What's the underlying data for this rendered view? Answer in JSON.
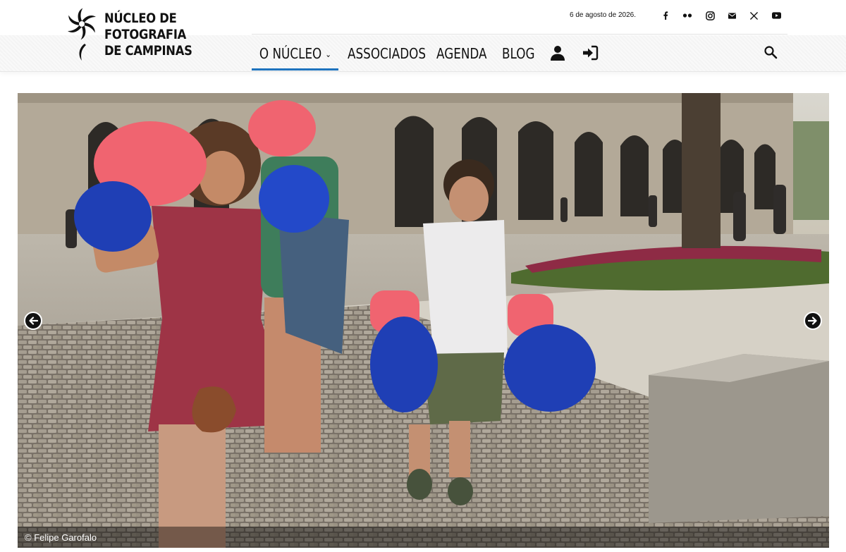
{
  "site": {
    "logo_lines": [
      "NÚCLEO DE",
      "FOTOGRAFIA",
      "DE CAMPINAS"
    ]
  },
  "topbar": {
    "date": "6 de agosto de 2026.",
    "social_icons": [
      "facebook-icon",
      "flickr-icon",
      "instagram-icon",
      "mail-icon",
      "x-icon",
      "youtube-icon"
    ]
  },
  "nav": {
    "items": [
      {
        "label": "O NÚCLEO",
        "has_dropdown": true,
        "active": true
      },
      {
        "label": "ASSOCIADOS"
      },
      {
        "label": "AGENDA"
      },
      {
        "label": "BLOG"
      }
    ],
    "user_icon": "user-icon",
    "login_icon": "login-icon",
    "search_icon": "search-icon"
  },
  "slider": {
    "caption": "© Felipe Garofalo",
    "prev_icon": "arrow-left-icon",
    "next_icon": "arrow-right-icon"
  },
  "colors": {
    "accent": "#1e73be",
    "text": "#111111"
  }
}
